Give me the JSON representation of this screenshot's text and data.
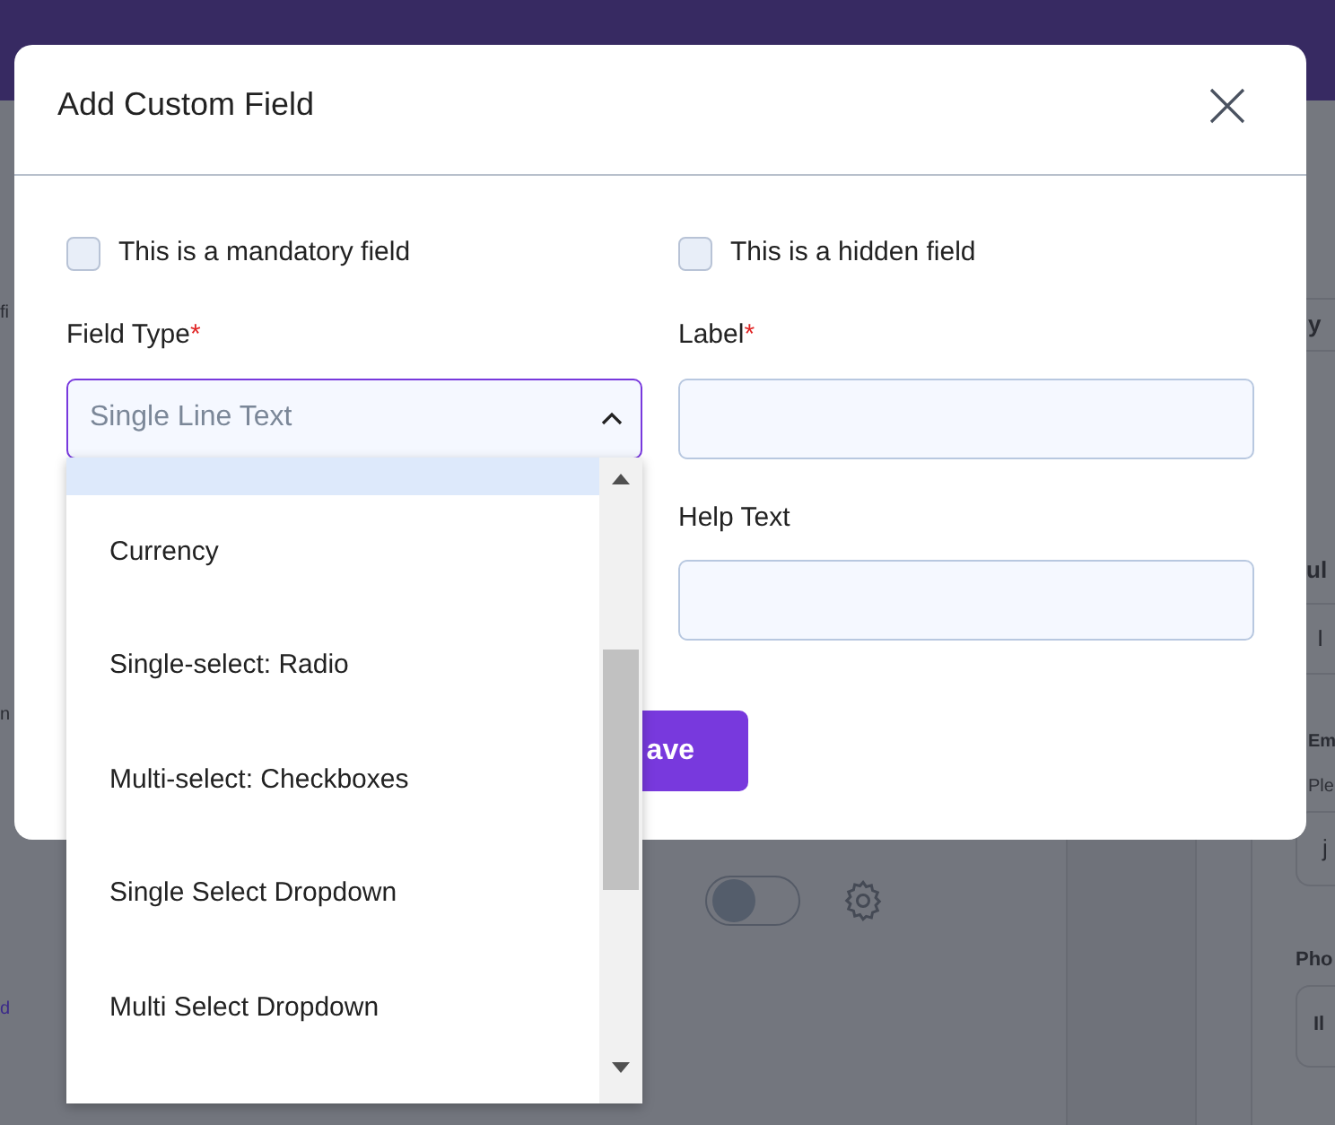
{
  "background": {
    "left_texts": [
      {
        "text": "fi"
      },
      {
        "text": "n"
      },
      {
        "text": "d",
        "kind": "link"
      }
    ],
    "toggle": {
      "on": false
    },
    "right_panel": {
      "header": "y",
      "full_label": "ul",
      "full_value": "I",
      "email_label": "Em",
      "email_hint": "Ple",
      "email_value": "j",
      "phone_label": "Pho",
      "phone_value": "Il"
    }
  },
  "modal": {
    "title": "Add Custom Field",
    "checkboxes": [
      {
        "label": "This is a mandatory field",
        "checked": false
      },
      {
        "label": "This is a hidden field",
        "checked": false
      }
    ],
    "field_type": {
      "label": "Field Type",
      "required_mark": "*",
      "value": "Single Line Text",
      "expanded": true
    },
    "label_field": {
      "label": "Label",
      "required_mark": "*"
    },
    "help_text": {
      "label": "Help Text"
    },
    "save_button": "ave",
    "options": [
      {
        "selected": true
      },
      {
        "label": "Currency",
        "selected": false
      },
      {
        "label": "Single-select: Radio",
        "selected": false
      },
      {
        "label": "Multi-select: Checkboxes",
        "selected": false
      },
      {
        "label": "Single Select Dropdown",
        "selected": false
      },
      {
        "label": "Multi Select Dropdown",
        "selected": false
      }
    ]
  }
}
